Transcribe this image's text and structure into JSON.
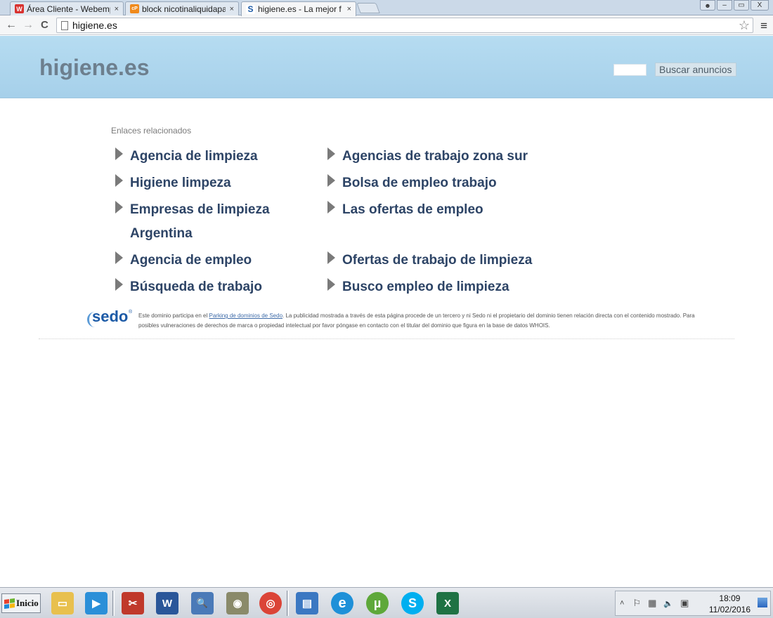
{
  "browser": {
    "tabs": [
      {
        "title": "Área Cliente - Webemp",
        "favicon": "W",
        "favicon_color": "#d8322f",
        "active": false
      },
      {
        "title": "block nicotinaliquidapa",
        "favicon": "cP",
        "favicon_color": "#f08a1c",
        "active": false
      },
      {
        "title": "higiene.es - La mejor f",
        "favicon": "S",
        "favicon_color": "#1c5aa6",
        "active": true
      }
    ],
    "close_glyph": "×",
    "url": "higiene.es",
    "back_glyph": "←",
    "forward_glyph": "→",
    "reload_glyph": "C",
    "star_glyph": "☆",
    "menu_glyph": "≡",
    "win_user_glyph": "👤",
    "win_min_glyph": "–",
    "win_max_glyph": "▭",
    "win_close_glyph": "X"
  },
  "header": {
    "site_title": "higiene.es",
    "search_value": "",
    "search_button": "Buscar anuncios",
    "bg_color": "#b1d8ee"
  },
  "related": {
    "label": "Enlaces relacionados",
    "left": [
      "Agencia de limpieza",
      "Higiene limpeza",
      "Empresas de limpieza Argentina",
      "Agencia de empleo",
      "Búsqueda de trabajo"
    ],
    "right": [
      "Agencias de trabajo zona sur",
      "Bolsa de empleo trabajo",
      "Las ofertas de empleo",
      "Ofertas de trabajo de limpieza",
      "Busco empleo de limpieza"
    ],
    "link_color": "#2d4466"
  },
  "footer": {
    "sedo_logo": "sedo",
    "sedo_reg": "®",
    "text_before": "Este dominio participa en el ",
    "link_text": "Parking de dominios de Sedo",
    "text_after": ". La publicidad mostrada a través de esta página procede de un tercero y ni Sedo ni el propietario del dominio tienen relación directa con el contenido mostrado. Para posibles vulneraciones de derechos de marca o propiedad intelectual por favor póngase en contacto con el titular del dominio que figura en la base de datos WHOIS."
  },
  "taskbar": {
    "start_label": "Inicio",
    "apps": [
      {
        "name": "explorer-icon",
        "glyph": "▭",
        "color": "#e8c04e"
      },
      {
        "name": "media-player-icon",
        "glyph": "▶",
        "color": "#2b8fd8"
      },
      {
        "name": "snipping-tool-icon",
        "glyph": "✂",
        "color": "#c0392b"
      },
      {
        "name": "word-icon",
        "glyph": "W",
        "color": "#2a5699"
      },
      {
        "name": "search-computer-icon",
        "glyph": "🔍",
        "color": "#4a7ab8"
      },
      {
        "name": "camera-icon",
        "glyph": "◉",
        "color": "#8a8a6a"
      },
      {
        "name": "chrome-icon",
        "glyph": "◎",
        "color": "#db4437"
      },
      {
        "name": "network-computer-icon",
        "glyph": "▤",
        "color": "#3b78c2"
      },
      {
        "name": "internet-explorer-icon",
        "glyph": "e",
        "color": "#1e90d8"
      },
      {
        "name": "utorrent-icon",
        "glyph": "µ",
        "color": "#5ea83a"
      },
      {
        "name": "skype-icon",
        "glyph": "S",
        "color": "#00aff0"
      },
      {
        "name": "excel-icon",
        "glyph": "X",
        "color": "#1f7244"
      }
    ],
    "tray_icons": [
      "˄",
      "⚐",
      "▦",
      "🔈",
      "▣"
    ],
    "time": "18:09",
    "date": "11/02/2016"
  }
}
